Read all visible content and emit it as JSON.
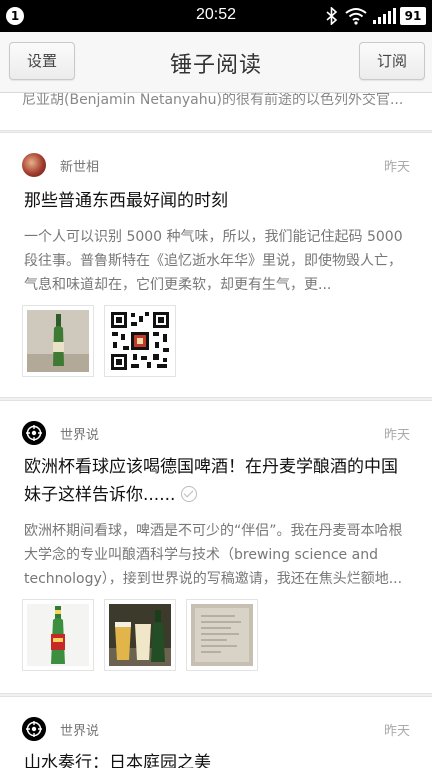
{
  "status_bar": {
    "notification_count": "1",
    "time": "20:52",
    "battery": "91",
    "icons": [
      "bluetooth-icon",
      "wifi-icon",
      "signal-icon"
    ]
  },
  "header": {
    "left_button": "设置",
    "title": "锤子阅读",
    "right_button": "订阅"
  },
  "feed": {
    "previous_summary_tail": "尼亚胡(Benjamin Netanyahu)的很有前途的以色列外交官...",
    "items": [
      {
        "source": "新世相",
        "time": "昨天",
        "title": "那些普通东西最好闻的时刻",
        "summary": "一个人可以识别 5000 种气味，所以，我们能记住起码 5000 段往事。普鲁斯特在《追忆逝水年华》里说，即使物毁人亡，气息和味道却在，它们更柔软，却更有生气，更...",
        "images": [
          "green-bottle-photo",
          "qr-code-image"
        ]
      },
      {
        "source": "世界说",
        "time": "昨天",
        "title": "欧洲杯看球应该喝德国啤酒！在丹麦学酿酒的中国妹子这样告诉你......",
        "summary": "欧洲杯期间看球，啤酒是不可少的“伴侣”。我在丹麦哥本哈根大学念的专业叫酿酒科学与技术（brewing science and technology），接到世界说的写稿邀请，我还在焦头烂额地...",
        "images": [
          "beer-bottle-photo",
          "beer-glasses-photo",
          "notebook-photo"
        ]
      },
      {
        "source": "世界说",
        "time": "昨天",
        "title": "山水奏行：日本庭园之美"
      }
    ]
  },
  "colors": {
    "status_bar": "#000000",
    "header_bg": "#f7f7f7",
    "feed_bg": "#f1f1f1",
    "card_bg": "#ffffff"
  }
}
